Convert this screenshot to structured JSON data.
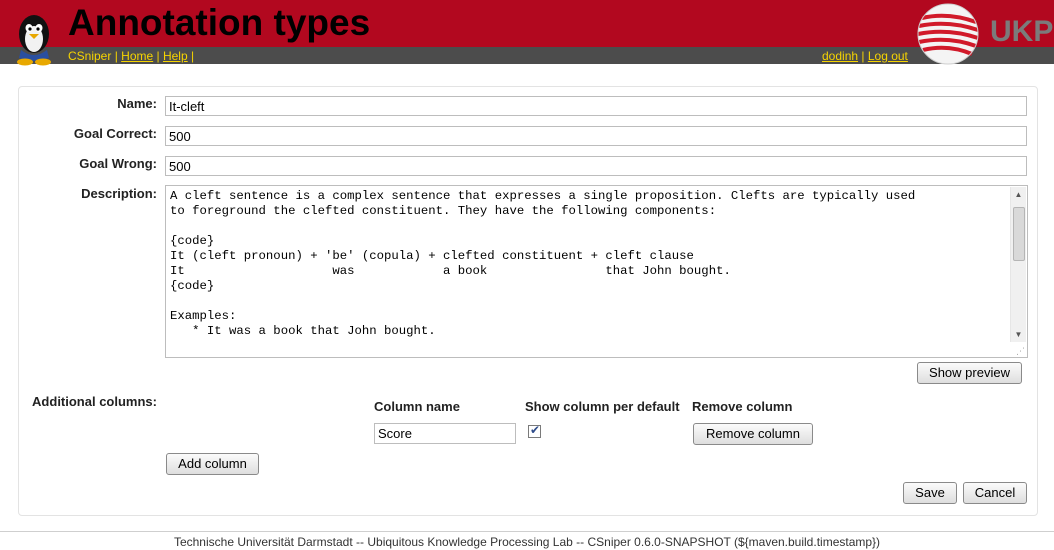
{
  "header": {
    "title": "Annotation types",
    "logo_text": "UKP"
  },
  "nav": {
    "app_name": "CSniper",
    "home": "Home",
    "help": "Help",
    "user": "dodinh",
    "logout": "Log out"
  },
  "form": {
    "labels": {
      "name": "Name:",
      "goal_correct": "Goal Correct:",
      "goal_wrong": "Goal Wrong:",
      "description": "Description:",
      "additional_columns": "Additional columns:"
    },
    "values": {
      "name": "It-cleft",
      "goal_correct": "500",
      "goal_wrong": "500"
    },
    "description_lines": [
      "A cleft sentence is a complex sentence that expresses a single proposition. Clefts are typically used",
      "to foreground the clefted constituent. They have the following components:",
      "",
      "{code}",
      "It (cleft pronoun) + 'be' (copula) + clefted constituent + cleft clause",
      "It                    was            a book                that John bought.",
      "{code}",
      "",
      "Examples:",
      "   * It was a book that John bought."
    ],
    "show_preview_label": "Show preview",
    "columns": {
      "headers": {
        "name": "Column name",
        "show_default": "Show column per default",
        "remove": "Remove column"
      },
      "rows": [
        {
          "name": "Score",
          "show_default": true,
          "remove_label": "Remove column"
        }
      ]
    },
    "add_column_label": "Add column",
    "save_label": "Save",
    "cancel_label": "Cancel"
  },
  "footer": {
    "text": "Technische Universität Darmstadt -- Ubiquitous Knowledge Processing Lab -- CSniper 0.6.0-SNAPSHOT (${maven.build.timestamp})"
  },
  "colors": {
    "header_red": "#b2081f",
    "nav_bar": "#4c4c4c",
    "nav_link": "#f6d400"
  },
  "icons": {
    "mascot": "penguin-mascot-icon",
    "logo": "ukp-logo-icon",
    "scroll_up": "triangle-up-icon",
    "scroll_down": "triangle-down-icon",
    "checkbox_mark": "check-icon"
  }
}
